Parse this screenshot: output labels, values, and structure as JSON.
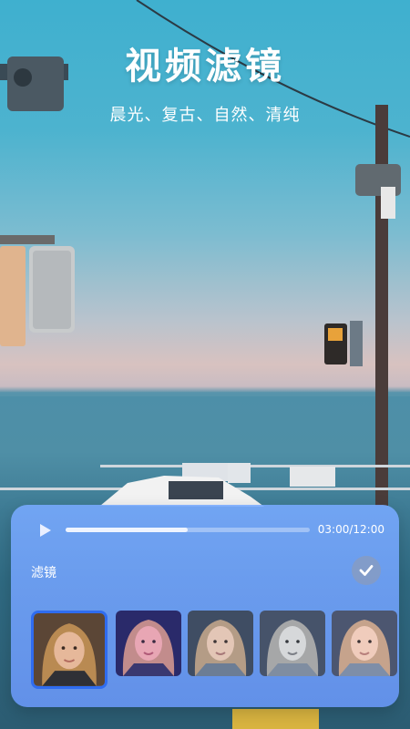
{
  "header": {
    "title": "视频滤镜",
    "subtitle": "晨光、复古、自然、清纯"
  },
  "player": {
    "time": "03:00/12:00",
    "progress": 0.5
  },
  "filters": {
    "label": "滤镜",
    "selected_index": 0,
    "items": [
      "filter-original",
      "filter-dawn",
      "filter-retro",
      "filter-natural",
      "filter-pure"
    ]
  },
  "colors": {
    "accent": "#2f6cf0",
    "panel": "#7ea9ff"
  }
}
